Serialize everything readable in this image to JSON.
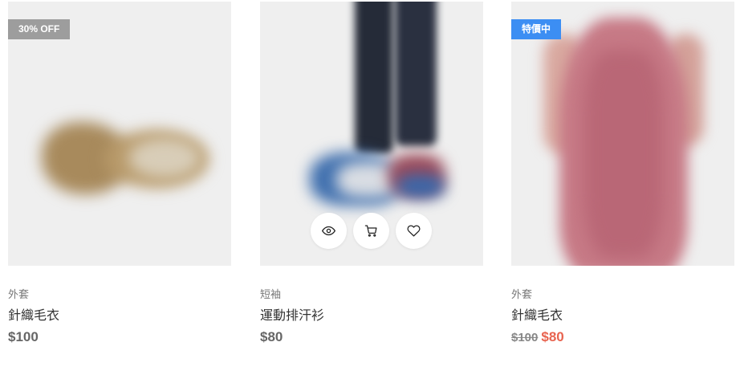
{
  "products": [
    {
      "badge": "30% OFF",
      "category": "外套",
      "name": "針織毛衣",
      "price": "$100"
    },
    {
      "category": "短袖",
      "name": "運動排汗衫",
      "price": "$80",
      "actions": [
        "eye-icon",
        "cart-icon",
        "heart-icon"
      ]
    },
    {
      "badge": "特價中",
      "category": "外套",
      "name": "針織毛衣",
      "old_price": "$100",
      "price": "$80"
    }
  ],
  "colors": {
    "badge_gray": "#9d9d9d",
    "badge_blue": "#3c8ef3",
    "sale_price": "#e8634f"
  }
}
